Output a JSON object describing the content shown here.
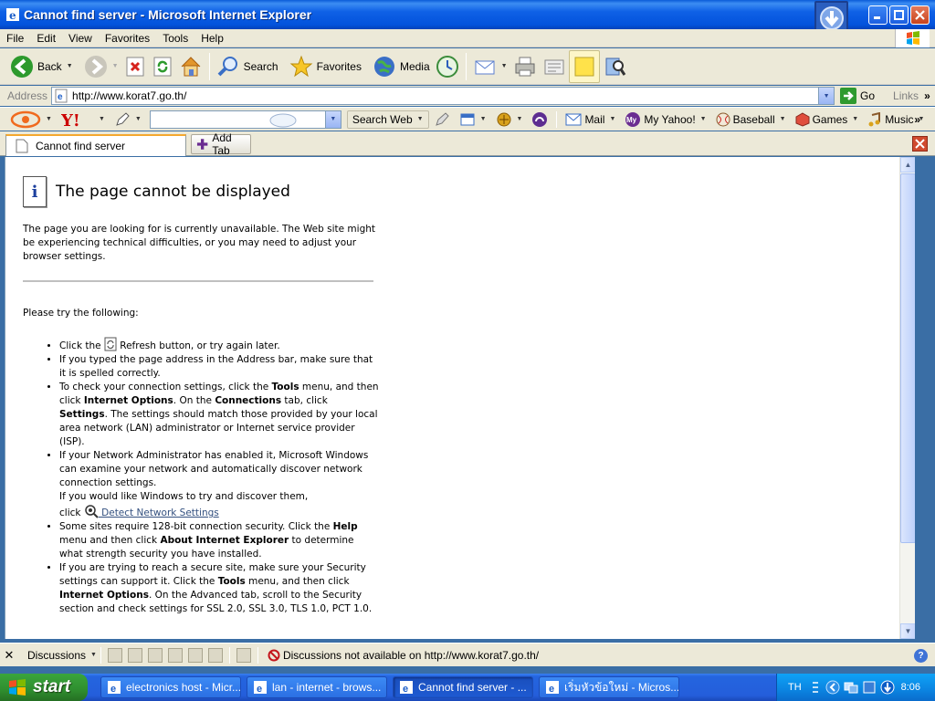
{
  "window": {
    "title": "Cannot find server - Microsoft Internet Explorer"
  },
  "menu": [
    "File",
    "Edit",
    "View",
    "Favorites",
    "Tools",
    "Help"
  ],
  "toolbar": {
    "back": "Back",
    "search": "Search",
    "favorites": "Favorites",
    "media": "Media"
  },
  "address": {
    "label": "Address",
    "url": "http://www.korat7.go.th/",
    "go": "Go",
    "links": "Links"
  },
  "yahoo": {
    "search_web": "Search Web",
    "mail": "Mail",
    "my_yahoo": "My Yahoo!",
    "baseball": "Baseball",
    "games": "Games",
    "music": "Music"
  },
  "tabs": {
    "active": "Cannot find server",
    "add": "Add Tab"
  },
  "content": {
    "title": "The page cannot be displayed",
    "intro": "The page you are looking for is currently unavailable. The Web site might be experiencing technical difficulties, or you may need to adjust your browser settings.",
    "try": "Please try the following:",
    "tip1_a": "Click the ",
    "tip1_b": " Refresh button, or try again later.",
    "tip2": "If you typed the page address in the Address bar, make sure that it is spelled correctly.",
    "tip3_a": "To check your connection settings, click the ",
    "tip3_tools": "Tools",
    "tip3_b": " menu, and then click ",
    "tip3_io": "Internet Options",
    "tip3_c": ". On the ",
    "tip3_conn": "Connections",
    "tip3_d": " tab, click ",
    "tip3_settings": "Settings",
    "tip3_e": ". The settings should match those provided by your local area network (LAN) administrator or Internet service provider (ISP).",
    "tip4_a": "If your Network Administrator has enabled it, Microsoft Windows can examine your network and automatically discover network connection settings.",
    "tip4_b": "If you would like Windows to try and discover them,",
    "tip4_click": "click",
    "tip4_link": " Detect Network Settings",
    "tip5_a": "Some sites require 128-bit connection security. Click the ",
    "tip5_help": "Help",
    "tip5_b": " menu and then click ",
    "tip5_about": "About Internet Explorer",
    "tip5_c": " to determine what strength security you have installed.",
    "tip6_a": "If you are trying to reach a secure site, make sure your Security settings can support it. Click the ",
    "tip6_tools": "Tools",
    "tip6_b": " menu, and then click ",
    "tip6_io": "Internet Options",
    "tip6_c": ". On the Advanced tab, scroll to the Security section and check settings for SSL 2.0, SSL 3.0, TLS 1.0, PCT 1.0."
  },
  "discussions": {
    "button": "Discussions",
    "status": "Discussions not available on http://www.korat7.go.th/"
  },
  "taskbar": {
    "start": "start",
    "tasks": [
      "electronics host - Micr...",
      "lan - internet - brows...",
      "Cannot find server - ...",
      "เริ่มหัวข้อใหม่ - Micros..."
    ],
    "lang": "TH",
    "clock": "8:06"
  },
  "colors": {
    "titlebar": "#0353dc",
    "chrome": "#ece9d8",
    "taskbar": "#245edb",
    "start": "#2f8e2f"
  }
}
